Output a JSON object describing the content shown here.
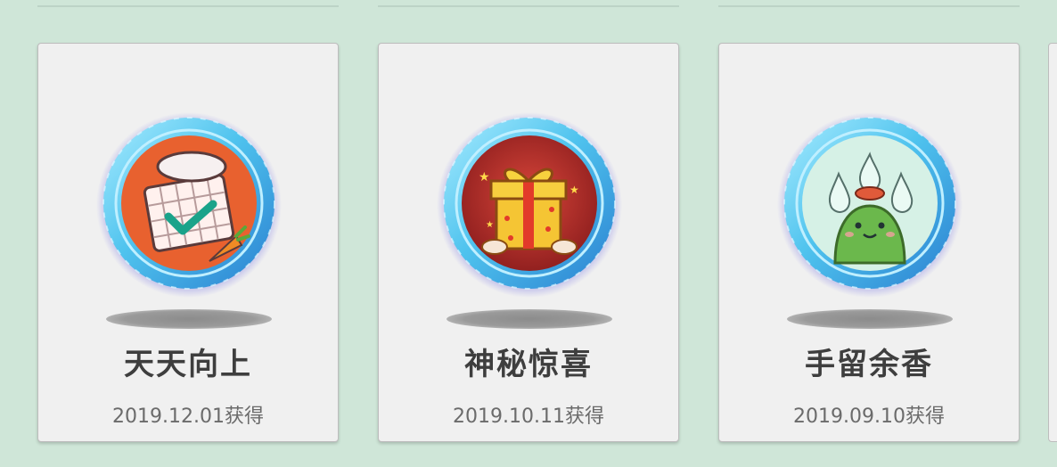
{
  "badges": [
    {
      "title": "天天向上",
      "date": "2019.12.01获得",
      "icon": "calendar-check-icon",
      "accent": "#e25a2b"
    },
    {
      "title": "神秘惊喜",
      "date": "2019.10.11获得",
      "icon": "gift-box-icon",
      "accent": "#a52424"
    },
    {
      "title": "手留余香",
      "date": "2019.09.10获得",
      "icon": "green-creature-icon",
      "accent": "#cfeee3"
    }
  ],
  "colors": {
    "background": "#cfe6d8",
    "card": "#f0f0f0",
    "ring": "#5ec8ee"
  }
}
